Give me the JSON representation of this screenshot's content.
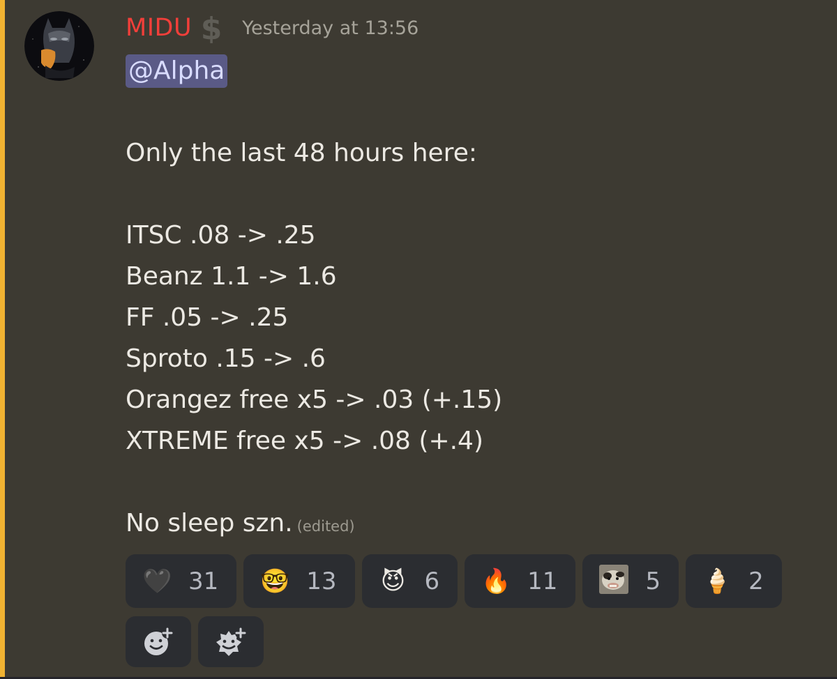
{
  "message": {
    "author": {
      "name": "MIDU",
      "role_icon": "dollar-icon"
    },
    "timestamp": "Yesterday at 13:56",
    "mention": "@Alpha",
    "intro": "Only the last 48 hours here:",
    "lines": [
      "ITSC .08 -> .25",
      "Beanz 1.1 -> 1.6",
      "FF .05 -> .25",
      "Sproto .15 -> .6",
      "Orangez free x5 -> .03 (+.15)",
      "XTREME free x5 -> .08 (+.4)"
    ],
    "closing": "No sleep szn.",
    "edited_label": "(edited)"
  },
  "reactions": [
    {
      "emoji": "🖤",
      "count": "31",
      "icon": "black-heart-icon"
    },
    {
      "emoji": "🤓",
      "count": "13",
      "icon": "nerd-face-icon"
    },
    {
      "emoji": "😈",
      "count": "6",
      "icon": "smiling-devil-icon"
    },
    {
      "emoji": "🔥",
      "count": "11",
      "icon": "fire-icon"
    },
    {
      "emoji": "",
      "count": "5",
      "icon": "custom-animal-emoji-icon"
    },
    {
      "emoji": "🍦",
      "count": "2",
      "icon": "ice-cream-icon"
    }
  ],
  "add_reaction_buttons": [
    {
      "icon": "add-reaction-icon"
    },
    {
      "icon": "add-super-reaction-icon"
    }
  ],
  "colors": {
    "username": "#f23f3a",
    "mention_bar": "#f0b232",
    "background": "#3d3a32",
    "reaction_bg": "#2b2d31",
    "mention_bg": "#5a5a86"
  }
}
